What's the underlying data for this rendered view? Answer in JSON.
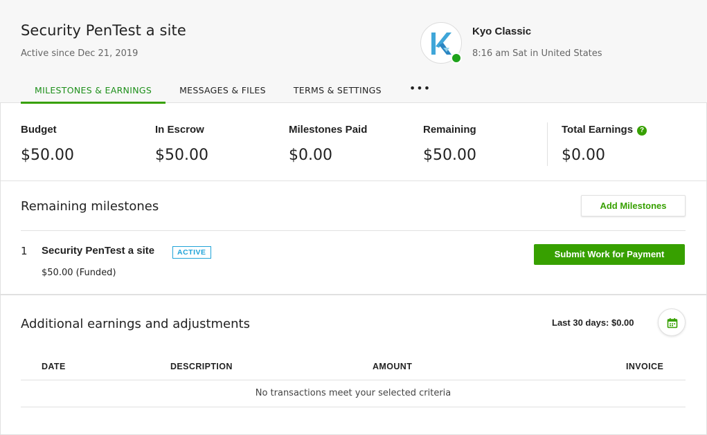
{
  "header": {
    "title": "Security PenTest a site",
    "subtitle": "Active since Dec 21, 2019",
    "client": {
      "name": "Kyo Classic",
      "local_time": "8:16 am Sat in United States",
      "status": "online"
    },
    "tabs": [
      {
        "label": "MILESTONES & EARNINGS",
        "active": true
      },
      {
        "label": "MESSAGES & FILES",
        "active": false
      },
      {
        "label": "TERMS & SETTINGS",
        "active": false
      }
    ],
    "more_label": "•••"
  },
  "stats": [
    {
      "label": "Budget",
      "value": "$50.00"
    },
    {
      "label": "In Escrow",
      "value": "$50.00"
    },
    {
      "label": "Milestones Paid",
      "value": "$0.00"
    },
    {
      "label": "Remaining",
      "value": "$50.00"
    },
    {
      "label": "Total Earnings",
      "value": "$0.00"
    }
  ],
  "milestones": {
    "title": "Remaining milestones",
    "add_button": "Add Milestones",
    "items": [
      {
        "number": "1",
        "title": "Security PenTest a site",
        "badge": "ACTIVE",
        "amount": "$50.00 (Funded)",
        "action": "Submit Work for Payment"
      }
    ]
  },
  "earnings": {
    "title": "Additional earnings and adjustments",
    "period_summary": "Last 30 days: $0.00",
    "columns": [
      "DATE",
      "DESCRIPTION",
      "AMOUNT",
      "INVOICE"
    ],
    "empty_message": "No transactions meet your selected criteria"
  },
  "colors": {
    "brand_green": "#37a000",
    "active_badge": "#1fa3d8",
    "online_dot": "#1fa31c"
  }
}
